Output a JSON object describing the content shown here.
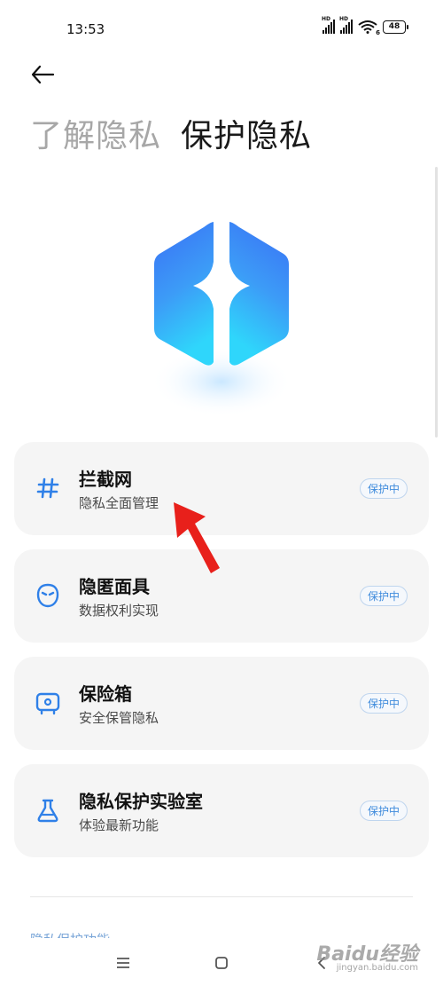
{
  "status_bar": {
    "time": "13:53",
    "signal1_label": "HD",
    "signal2_label": "HD",
    "wifi_label": "6",
    "battery": "48"
  },
  "tabs": [
    {
      "label": "了解隐私",
      "active": false
    },
    {
      "label": "保护隐私",
      "active": true
    }
  ],
  "hero": {
    "icon": "privacy-shield-cube-icon",
    "colors": [
      "#3f7ef7",
      "#2fdaf9"
    ]
  },
  "cards": [
    {
      "title": "拦截网",
      "subtitle": "隐私全面管理",
      "badge": "保护中",
      "icon": "hash-icon"
    },
    {
      "title": "隐匿面具",
      "subtitle": "数据权利实现",
      "badge": "保护中",
      "icon": "mask-icon"
    },
    {
      "title": "保险箱",
      "subtitle": "安全保管隐私",
      "badge": "保护中",
      "icon": "safe-icon"
    },
    {
      "title": "隐私保护实验室",
      "subtitle": "体验最新功能",
      "badge": "保护中",
      "icon": "flask-icon"
    }
  ],
  "section_peek": "隐私保护功能",
  "nav": {
    "menu_icon": "menu-icon",
    "home_icon": "home-icon",
    "back_icon": "back-icon"
  },
  "watermark": {
    "main": "Baidu经验",
    "sub": "jingyan.baidu.com"
  },
  "colors": {
    "accent": "#3f8bdc",
    "card_bg": "#f5f5f5",
    "icon_blue": "#2f80e8",
    "arrow_red": "#e8201b"
  }
}
